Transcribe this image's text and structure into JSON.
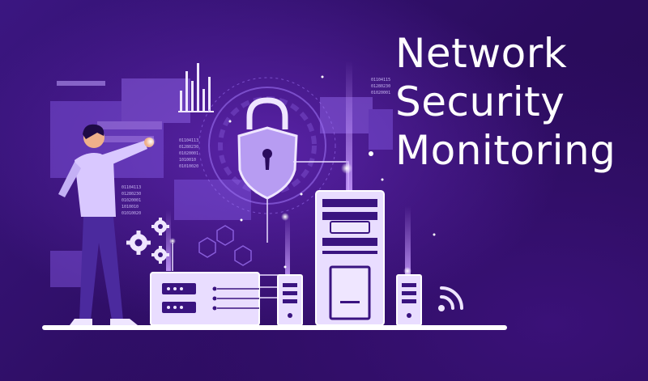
{
  "title": {
    "line1": "Network",
    "line2": "Security",
    "line3": "Monitoring"
  },
  "colors": {
    "background": "#2b0c5e",
    "accent": "#a87bff",
    "title": "#ffffff",
    "device_fill": "#e9ddff"
  },
  "icons": [
    "padlock-shield-icon",
    "gear-icon",
    "wifi-signal-icon",
    "server-icon",
    "person-icon"
  ]
}
